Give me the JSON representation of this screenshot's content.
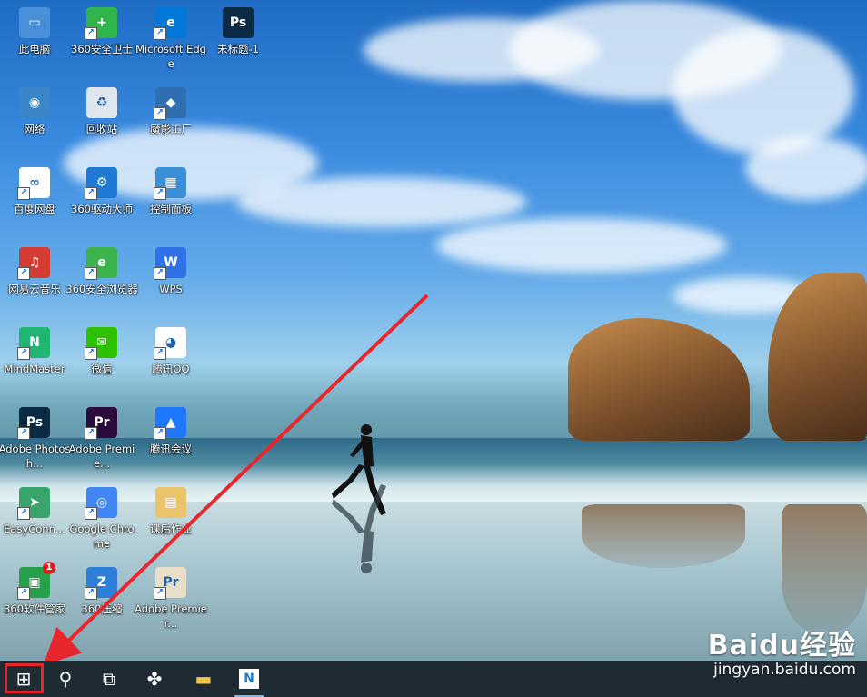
{
  "desktop_icons": [
    {
      "label": "此电脑",
      "icon": "computer-icon",
      "color": "#4a90d9",
      "glyph": "▭"
    },
    {
      "label": "网络",
      "icon": "network-icon",
      "color": "#3a86c8",
      "glyph": "◉"
    },
    {
      "label": "百度网盘",
      "icon": "baidu-netdisk-icon",
      "color": "#ffffff",
      "glyph": "∞"
    },
    {
      "label": "网易云音乐",
      "icon": "netease-music-icon",
      "color": "#d43c33",
      "glyph": "♫"
    },
    {
      "label": "MindMaster",
      "icon": "mindmaster-icon",
      "color": "#21b573",
      "glyph": "N"
    },
    {
      "label": "Adobe Photosh...",
      "icon": "photoshop-icon",
      "color": "#0b2a44",
      "glyph": "Ps"
    },
    {
      "label": "EasyConn...",
      "icon": "easyconnect-icon",
      "color": "#3aa56a",
      "glyph": "➤"
    },
    {
      "label": "360软件管家",
      "icon": "360-software-icon",
      "color": "#25a04b",
      "glyph": "▣"
    },
    {
      "label": "360安全卫士",
      "icon": "360-security-icon",
      "color": "#2fb54a",
      "glyph": "+"
    },
    {
      "label": "回收站",
      "icon": "recycle-bin-icon",
      "color": "#dfe6ee",
      "glyph": "♻"
    },
    {
      "label": "360驱动大师",
      "icon": "360-driver-icon",
      "color": "#1f7ad6",
      "glyph": "⚙"
    },
    {
      "label": "360安全浏览器",
      "icon": "360-browser-icon",
      "color": "#3cb44b",
      "glyph": "e"
    },
    {
      "label": "微信",
      "icon": "wechat-icon",
      "color": "#2dc100",
      "glyph": "✉"
    },
    {
      "label": "Adobe Premie...",
      "icon": "premiere-icon",
      "color": "#2a0b3c",
      "glyph": "Pr"
    },
    {
      "label": "Google Chrome",
      "icon": "chrome-icon",
      "color": "#4285f4",
      "glyph": "◎"
    },
    {
      "label": "360压缩",
      "icon": "360-zip-icon",
      "color": "#2d7fd8",
      "glyph": "Z"
    },
    {
      "label": "Microsoft Edge",
      "icon": "edge-icon",
      "color": "#0078d7",
      "glyph": "e"
    },
    {
      "label": "魔影工厂",
      "icon": "moying-factory-icon",
      "color": "#2d6fb0",
      "glyph": "◆"
    },
    {
      "label": "控制面板",
      "icon": "control-panel-icon",
      "color": "#3a8fd6",
      "glyph": "▦"
    },
    {
      "label": "WPS",
      "icon": "wps-icon",
      "color": "#2f72e8",
      "glyph": "W"
    },
    {
      "label": "腾讯QQ",
      "icon": "qq-icon",
      "color": "#ffffff",
      "glyph": "◕"
    },
    {
      "label": "腾讯会议",
      "icon": "tencent-meeting-icon",
      "color": "#1e78ff",
      "glyph": "▲"
    },
    {
      "label": "课后作业",
      "icon": "folder-icon",
      "color": "#e9c46a",
      "glyph": "▤"
    },
    {
      "label": "Adobe Premier...",
      "icon": "premiere-file-icon",
      "color": "#e9dfc9",
      "glyph": "Pr"
    },
    {
      "label": "未标题-1",
      "icon": "psd-file-icon",
      "color": "#0b2a44",
      "glyph": "Ps"
    }
  ],
  "badges": {
    "software_manager_count": "1"
  },
  "taskbar": {
    "items": [
      {
        "name": "start-button",
        "icon": "windows-logo-icon",
        "glyph": "⊞"
      },
      {
        "name": "search-button",
        "icon": "search-icon",
        "glyph": "⚲"
      },
      {
        "name": "task-view-button",
        "icon": "task-view-icon",
        "glyph": "⧉"
      },
      {
        "name": "fan-app-button",
        "icon": "pinwheel-icon",
        "glyph": "✤"
      },
      {
        "name": "file-explorer-button",
        "icon": "folder-icon",
        "glyph": "▬"
      },
      {
        "name": "active-app-button",
        "icon": "app-n-icon",
        "glyph": "N"
      }
    ]
  },
  "watermark": {
    "brand": "Baidu经验",
    "url": "jingyan.baidu.com"
  },
  "colors": {
    "highlight": "#e8262e",
    "taskbar": "#1e2b33"
  }
}
